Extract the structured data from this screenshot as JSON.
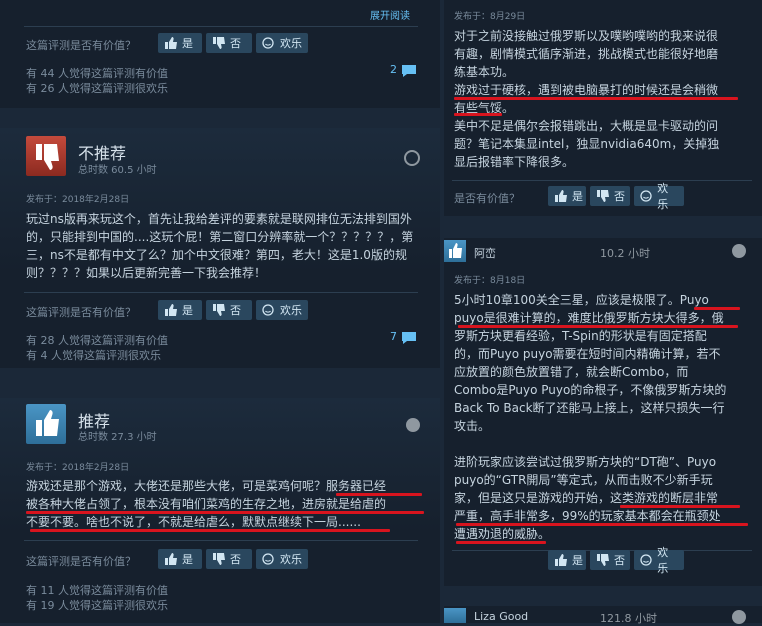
{
  "left": {
    "top_section": {
      "read_more": "展开阅读",
      "helpful_q": "这篇评测是否有价值？",
      "yes": "是",
      "no": "否",
      "funny": "欢乐",
      "helpful_count": "有 44 人觉得这篇评测有价值",
      "funny_count": "有 26 人觉得这篇评测很欢乐",
      "comments": "2"
    },
    "review1": {
      "verdict": "不推荐",
      "hours": "总时数 60.5 小时",
      "posted": "发布于：2018年2月28日",
      "body": "玩过ns版再来玩这个，首先让我给差评的要素就是联网排位无法排到国外的，只能排到中国的....这玩个屁！第二窗口分辨率就一个？？？？？，第三，ns不是都有中文了么？加个中文很难？第四，老大！这是1.0版的规则？？？？如果以后更新完善一下我会推荐！",
      "helpful_q": "这篇评测是否有价值？",
      "yes": "是",
      "no": "否",
      "funny": "欢乐",
      "helpful_count": "有 28 人觉得这篇评测有价值",
      "funny_count": "有 4 人觉得这篇评测很欢乐",
      "comments": "7"
    },
    "review2": {
      "verdict": "推荐",
      "hours": "总时数 27.3 小时",
      "posted": "发布于：2018年2月28日",
      "body_lines": [
        "游戏还是那个游戏，大佬还是那些大佬，可是菜鸡何呢？服务器已经",
        "被各种大佬占领了，根本没有咱们菜鸡的生存之地，进房就是给虐的",
        "不要不要。啥也不说了，不就是给虐么，默默点继续下一局......"
      ],
      "helpful_q": "这篇评测是否有价值？",
      "yes": "是",
      "no": "否",
      "funny": "欢乐",
      "helpful_count": "有 11 人觉得这篇评测有价值",
      "funny_count": "有 19 人觉得这篇评测很欢乐"
    }
  },
  "right": {
    "review_a": {
      "posted": "发布于：8月29日",
      "body_lines": [
        "对于之前没接触过俄罗斯以及噗哟噗哟的我来说很",
        "有趣，剧情模式循序渐进，挑战模式也能很好地磨",
        "练基本功。",
        "游戏过于硬核，遇到被电脑暴打的时候还是会稍微",
        "有些气馁。",
        "美中不足是偶尔会报错跳出，大概是显卡驱动的问",
        "题？笔记本集显intel，独显nvidia640m，关掉独",
        "显后报错率下降很多。"
      ],
      "helpful_q": "是否有价值？",
      "yes": "是",
      "no": "否",
      "funny": "欢乐"
    },
    "review_b": {
      "author": "阿峦",
      "hours": "10.2 小时",
      "posted": "发布于：8月18日",
      "body_lines": [
        "5小时10章100关全三星，应该是极限了。Puyo",
        "puyo是很难计算的，难度比俄罗斯方块大得多，俄",
        "罗斯方块更看经验，T-Spin的形状是有固定搭配",
        "的，而Puyo puyo需要在短时间内精确计算，若不",
        "应放置的颜色放置错了，就会断Combo，而",
        "Combo是Puyo Puyo的命根子，不像俄罗斯方块的",
        "Back To Back断了还能马上接上，这样只损失一行",
        "攻击。",
        "",
        "进阶玩家应该尝试过俄罗斯方块的“DT砲”、Puyo",
        "puyo的“GTR開局”等定式，从而击败不少新手玩",
        "家，但是这只是游戏的开始，这类游戏的断层非常",
        "严重，高手非常多，99%的玩家基本都会在瓶颈处",
        "遭遇劝退的威胁。"
      ],
      "yes": "是",
      "no": "否",
      "funny": "欢乐"
    },
    "review_c": {
      "author": "Liza Good",
      "hours": "121.8 小时"
    }
  },
  "colors": {
    "background": "#1b2838",
    "accent": "#66c0f4",
    "highlight_line": "#d8141e"
  }
}
